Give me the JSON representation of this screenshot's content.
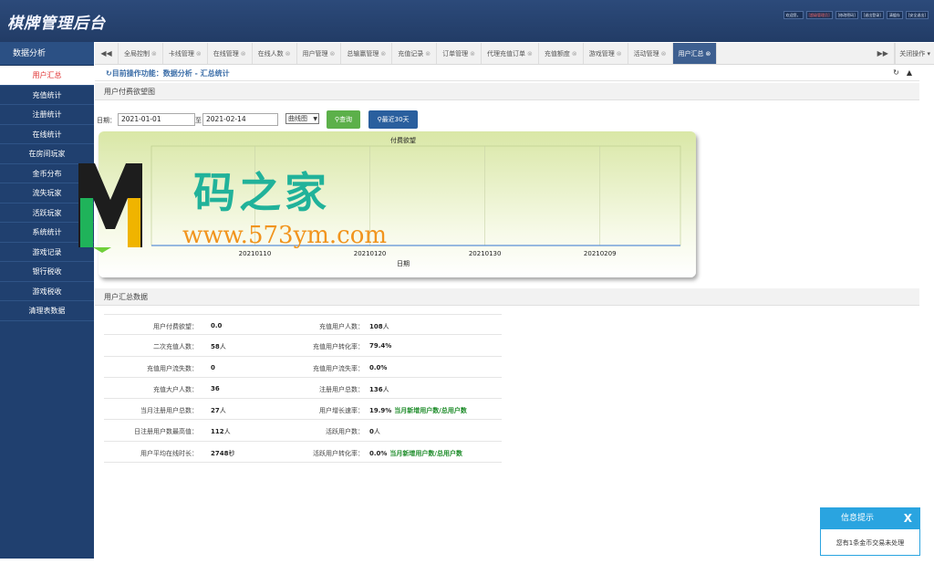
{
  "header": {
    "brand": "棋牌管理后台",
    "links": [
      "欢迎您，",
      "[超级管理员]",
      "[修改密码]",
      "[退出登录]",
      "清缓存",
      "[安全退出]"
    ]
  },
  "sidebar": {
    "title": "数据分析",
    "items": [
      {
        "label": "用户汇总",
        "active": true
      },
      {
        "label": "充值统计"
      },
      {
        "label": "注册统计"
      },
      {
        "label": "在线统计"
      },
      {
        "label": "在房间玩家"
      },
      {
        "label": "金币分布"
      },
      {
        "label": "流失玩家"
      },
      {
        "label": "活跃玩家"
      },
      {
        "label": "系统统计"
      },
      {
        "label": "游戏记录"
      },
      {
        "label": "银行税收"
      },
      {
        "label": "游戏税收"
      },
      {
        "label": "清理表数据"
      }
    ]
  },
  "tabs": {
    "items": [
      "全局控制",
      "卡线管理",
      "在线管理",
      "在线人数",
      "用户管理",
      "总输赢管理",
      "充值记录",
      "订单管理",
      "代理充值订单",
      "充值额度",
      "游戏管理",
      "活动管理",
      "用户汇总"
    ],
    "active": "用户汇总",
    "close_ops": "关闭操作"
  },
  "breadcrumb": {
    "text": "目前操作功能：数据分析 - 汇总统计"
  },
  "chart_section": {
    "title": "用户付费欲望图"
  },
  "filter": {
    "date_label": "日期：",
    "to_label": "至",
    "start_date": "2021-01-01",
    "end_date": "2021-02-14",
    "chart_type": "曲线图",
    "query_button": "查询",
    "recent_button": "最近30天"
  },
  "chart_data": {
    "type": "line",
    "title": "付费欲望",
    "xlabel": "日期",
    "ylabel": "",
    "x_ticks": [
      "20210110",
      "20210120",
      "20210130",
      "20210209"
    ],
    "series": [
      {
        "values": [
          0,
          0,
          0,
          0,
          0
        ]
      }
    ],
    "grid": true
  },
  "summary_section": {
    "title": "用户汇总数据"
  },
  "summary": [
    {
      "l1": "用户付费欲望：",
      "v1": "0.0",
      "u1": "",
      "l2": "充值用户人数：",
      "v2": "108",
      "u2": "人",
      "n2": ""
    },
    {
      "l1": "二次充值人数：",
      "v1": "58",
      "u1": "人",
      "l2": "充值用户转化率：",
      "v2": "79.4%",
      "u2": "",
      "n2": ""
    },
    {
      "l1": "充值用户流失数：",
      "v1": "0",
      "u1": "",
      "l2": "充值用户流失率：",
      "v2": "0.0%",
      "u2": "",
      "n2": ""
    },
    {
      "l1": "充值大户人数：",
      "v1": "36",
      "u1": "",
      "l2": "注册用户总数：",
      "v2": "136",
      "u2": "人",
      "n2": ""
    },
    {
      "l1": "当月注册用户总数：",
      "v1": "27",
      "u1": "人",
      "l2": "用户增长速率：",
      "v2": "19.9%",
      "u2": "",
      "n2": "当月新增用户数/总用户数"
    },
    {
      "l1": "日注册用户数最高值：",
      "v1": "112",
      "u1": "人",
      "l2": "活跃用户数：",
      "v2": "0",
      "u2": "人",
      "n2": ""
    },
    {
      "l1": "用户平均在线时长：",
      "v1": "2748",
      "u1": "秒",
      "l2": "活跃用户转化率：",
      "v2": "0.0%",
      "u2": "",
      "n2": "当月新增用户数/总用户数"
    }
  ],
  "watermark": {
    "cn": "码之家",
    "url": "www.573ym.com"
  },
  "notice": {
    "title": "信息提示",
    "close": "X",
    "body": "您有1条金币交易未处理"
  },
  "colors": {
    "header": "#223c66",
    "sidebar": "#20406f",
    "active_tab": "#3d5f90",
    "query_green": "#5cb04a",
    "recent_blue": "#2a5f9e",
    "notice_blue": "#2aa4e0",
    "note_green": "#1e8c2a"
  },
  "icons": {
    "breadcrumb": "refresh-icon",
    "tab_close": "circle-x-icon",
    "nav_prev": "double-left-icon",
    "nav_next": "double-right-icon"
  }
}
